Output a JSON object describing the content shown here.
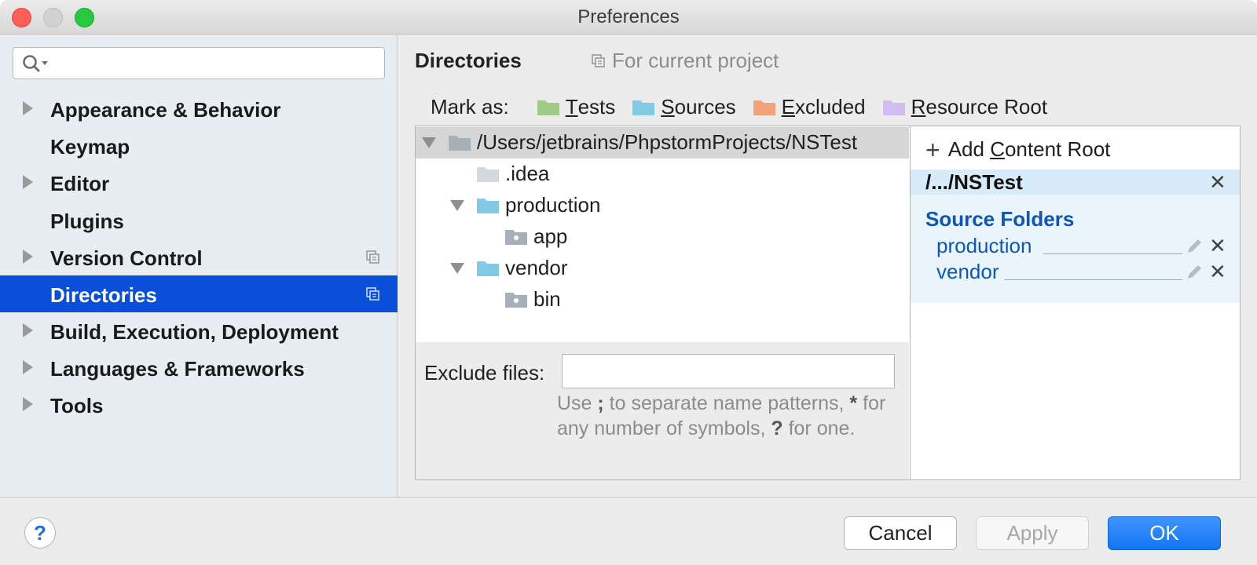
{
  "window": {
    "title": "Preferences"
  },
  "search": {
    "placeholder": "",
    "value": ""
  },
  "sidebar": {
    "items": [
      {
        "label": "Appearance & Behavior",
        "expandable": true,
        "project_scoped": false,
        "selected": false
      },
      {
        "label": "Keymap",
        "expandable": false,
        "project_scoped": false,
        "selected": false
      },
      {
        "label": "Editor",
        "expandable": true,
        "project_scoped": false,
        "selected": false
      },
      {
        "label": "Plugins",
        "expandable": false,
        "project_scoped": false,
        "selected": false
      },
      {
        "label": "Version Control",
        "expandable": true,
        "project_scoped": true,
        "selected": false
      },
      {
        "label": "Directories",
        "expandable": false,
        "project_scoped": true,
        "selected": true
      },
      {
        "label": "Build, Execution, Deployment",
        "expandable": true,
        "project_scoped": false,
        "selected": false
      },
      {
        "label": "Languages & Frameworks",
        "expandable": true,
        "project_scoped": false,
        "selected": false
      },
      {
        "label": "Tools",
        "expandable": true,
        "project_scoped": false,
        "selected": false
      }
    ]
  },
  "content": {
    "title": "Directories",
    "scope_note": "For current project",
    "mark_as": {
      "label": "Mark as:",
      "options": [
        {
          "mnemonic": "T",
          "rest": "ests",
          "color": "#9ccc86"
        },
        {
          "mnemonic": "S",
          "rest": "ources",
          "color": "#82cbe6"
        },
        {
          "mnemonic": "E",
          "rest": "xcluded",
          "color": "#f1a47a"
        },
        {
          "mnemonic": "R",
          "rest": "esource Root",
          "color": "#d1bdf0"
        }
      ]
    },
    "tree": {
      "root": "/Users/jetbrains/PhpstormProjects/NSTest",
      "nodes": [
        {
          "label": ".idea",
          "type": "plain"
        },
        {
          "label": "production",
          "type": "source"
        },
        {
          "label": "app",
          "type": "package"
        },
        {
          "label": "vendor",
          "type": "source"
        },
        {
          "label": "bin",
          "type": "package"
        }
      ]
    },
    "exclude": {
      "label": "Exclude files:",
      "value": "",
      "hint_parts": [
        "Use ",
        ";",
        " to separate name patterns, ",
        "*",
        " for any number of symbols, ",
        "?",
        " for one."
      ]
    },
    "roots": {
      "add_prefix": "Add ",
      "add_mnemonic": "C",
      "add_rest": "ontent Root",
      "root_path": "/.../NSTest",
      "source_folders_title": "Source Folders",
      "source_folders": [
        "production",
        "vendor"
      ]
    }
  },
  "buttons": {
    "help": "?",
    "cancel": "Cancel",
    "apply": "Apply",
    "ok": "OK"
  },
  "colors": {
    "selection": "#0a4fd9",
    "source_folder_text": "#0e56b5",
    "ok_button": "#1275f2"
  }
}
